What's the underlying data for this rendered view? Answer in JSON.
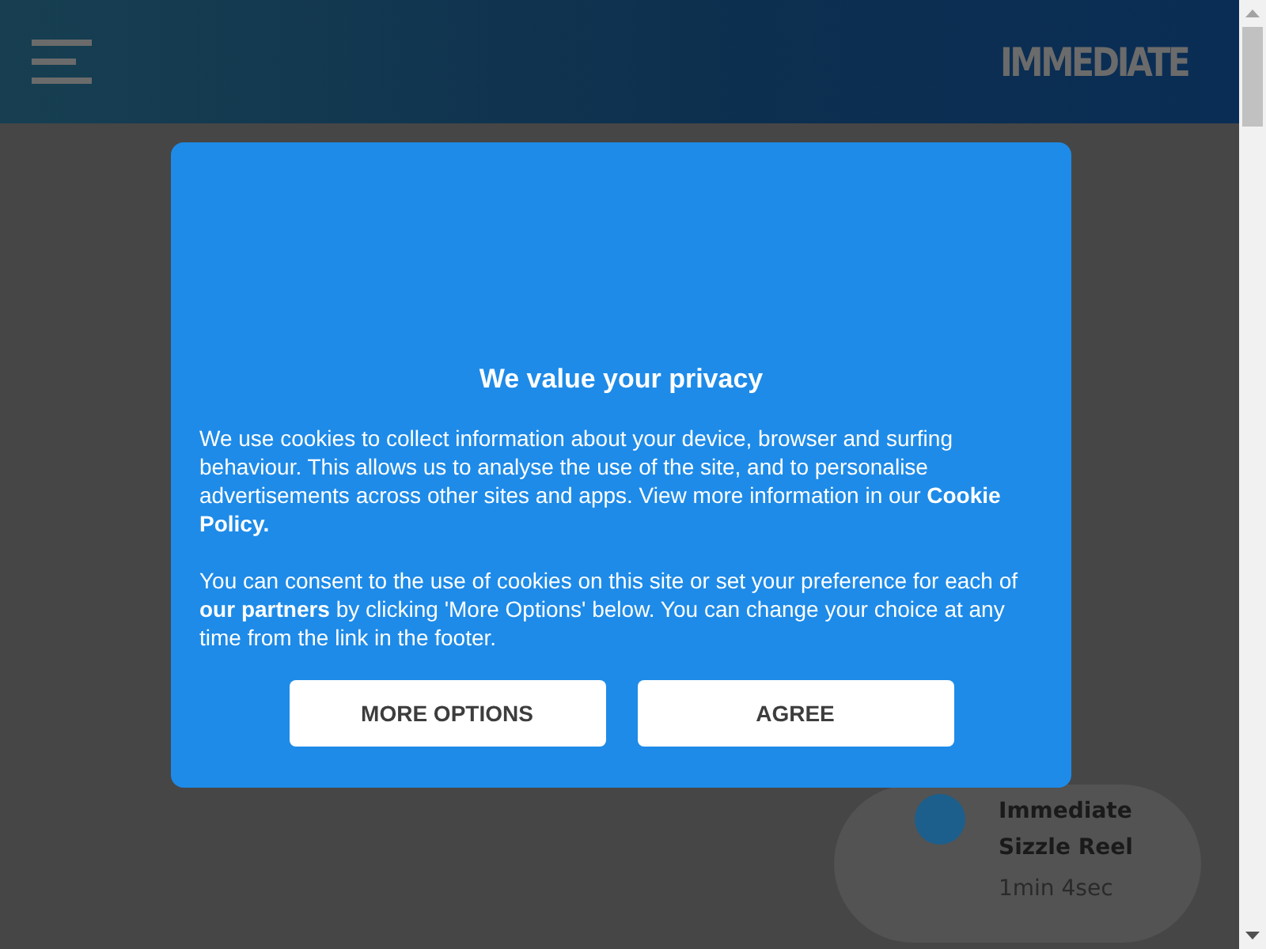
{
  "header": {
    "logo": "IMMEDIATE"
  },
  "video_card": {
    "title": "Immediate Sizzle Reel",
    "duration": "1min 4sec"
  },
  "consent_dialog": {
    "title": "We value your privacy",
    "paragraphs": [
      "We use cookies to collect information about your device, browser and surfing behaviour. This allows us to analyse the use of the site, and to personalise advertisements across other sites and apps. View more information in our **Cookie Policy.**",
      "You can consent to the use of cookies on this site or set your preference for each of **our partners** by clicking 'More Options' below. You can change your choice at any time from the link in the footer."
    ],
    "buttons": [
      "MORE OPTIONS",
      "AGREE"
    ]
  }
}
